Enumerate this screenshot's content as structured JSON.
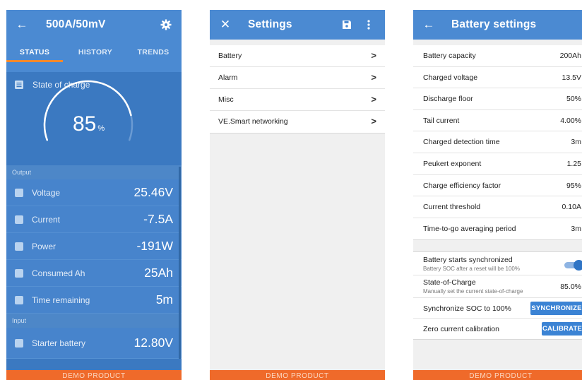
{
  "status_screen": {
    "title": "500A/50mV",
    "tabs": [
      "STATUS",
      "HISTORY",
      "TRENDS"
    ],
    "soc_label": "State of charge",
    "soc_value": "85",
    "soc_unit": "%",
    "soc_fraction": 0.85,
    "output_header": "Output",
    "output_rows": [
      {
        "label": "Voltage",
        "value": "25.46V",
        "icon": "lightning-icon"
      },
      {
        "label": "Current",
        "value": "-7.5A",
        "icon": "current-icon"
      },
      {
        "label": "Power",
        "value": "-191W",
        "icon": "power-icon"
      },
      {
        "label": "Consumed Ah",
        "value": "25Ah",
        "icon": "consumed-icon"
      },
      {
        "label": "Time remaining",
        "value": "5m",
        "icon": "clock-icon"
      }
    ],
    "input_header": "Input",
    "input_rows": [
      {
        "label": "Starter battery",
        "value": "12.80V",
        "icon": "battery-icon"
      }
    ],
    "demo_label": "DEMO PRODUCT"
  },
  "settings_screen": {
    "title": "Settings",
    "items": [
      "Battery",
      "Alarm",
      "Misc",
      "VE.Smart networking"
    ],
    "demo_label": "DEMO PRODUCT"
  },
  "battery_screen": {
    "title": "Battery settings",
    "rows": [
      {
        "label": "Battery capacity",
        "value": "200Ah"
      },
      {
        "label": "Charged voltage",
        "value": "13.5V"
      },
      {
        "label": "Discharge floor",
        "value": "50%"
      },
      {
        "label": "Tail current",
        "value": "4.00%"
      },
      {
        "label": "Charged detection time",
        "value": "3m"
      },
      {
        "label": "Peukert exponent",
        "value": "1.25"
      },
      {
        "label": "Charge efficiency factor",
        "value": "95%"
      },
      {
        "label": "Current threshold",
        "value": "0.10A"
      },
      {
        "label": "Time-to-go averaging period",
        "value": "3m"
      }
    ],
    "sync_title": "Battery starts synchronized",
    "sync_sub": "Battery SOC after a reset will be 100%",
    "sync_on": true,
    "soc_title": "State-of-Charge",
    "soc_sub": "Manually set the current state-of-charge",
    "soc_value": "85.0%",
    "synchronize_label": "Synchronize SOC to 100%",
    "synchronize_button": "SYNCHRONIZE",
    "calibration_label": "Zero current calibration",
    "calibrate_button": "CALIBRATE",
    "demo_label": "DEMO PRODUCT"
  },
  "colors": {
    "appbar": "#4b8ad2",
    "status_bg": "#3b79c1",
    "accent_orange": "#f3892c",
    "demo_bar": "#ef6a2a",
    "button_blue": "#3b83d4"
  }
}
